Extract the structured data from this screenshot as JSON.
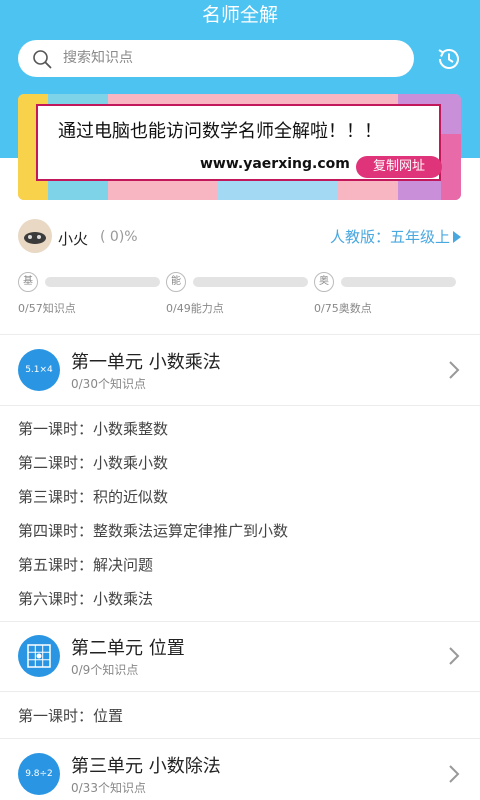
{
  "header": {
    "title": "名师全解"
  },
  "search": {
    "placeholder": "搜索知识点"
  },
  "banner": {
    "headline": "通过电脑也能访问数学名师全解啦！！！",
    "url": "www.yaerxing.com",
    "copy_label": "复制网址"
  },
  "user": {
    "name": "小火",
    "progress": "( 0)%",
    "grade": "人教版：五年级上"
  },
  "stats": [
    {
      "badge": "基",
      "count": "0/57知识点",
      "progress": 0
    },
    {
      "badge": "能",
      "count": "0/49能力点",
      "progress": 0
    },
    {
      "badge": "奥",
      "count": "0/75奥数点",
      "progress": 0
    }
  ],
  "units": [
    {
      "icon_text": "5.1×4",
      "title": "第一单元  小数乘法",
      "subtitle": "0/30个知识点",
      "lessons": [
        "第一课时：小数乘整数",
        "第二课时：小数乘小数",
        "第三课时：积的近似数",
        "第四课时：整数乘法运算定律推广到小数",
        "第五课时：解决问题",
        "第六课时：小数乘法"
      ]
    },
    {
      "icon_text": "",
      "icon": "grid-icon",
      "title": "第二单元  位置",
      "subtitle": "0/9个知识点",
      "lessons": [
        "第一课时：位置"
      ]
    },
    {
      "icon_text": "9.8÷2",
      "title": "第三单元  小数除法",
      "subtitle": "0/33个知识点",
      "lessons": []
    }
  ],
  "colors": {
    "header": "#4dc3f2",
    "accent": "#2a96e3",
    "grade": "#4aa8e0",
    "copy_button": "#e0347a"
  }
}
